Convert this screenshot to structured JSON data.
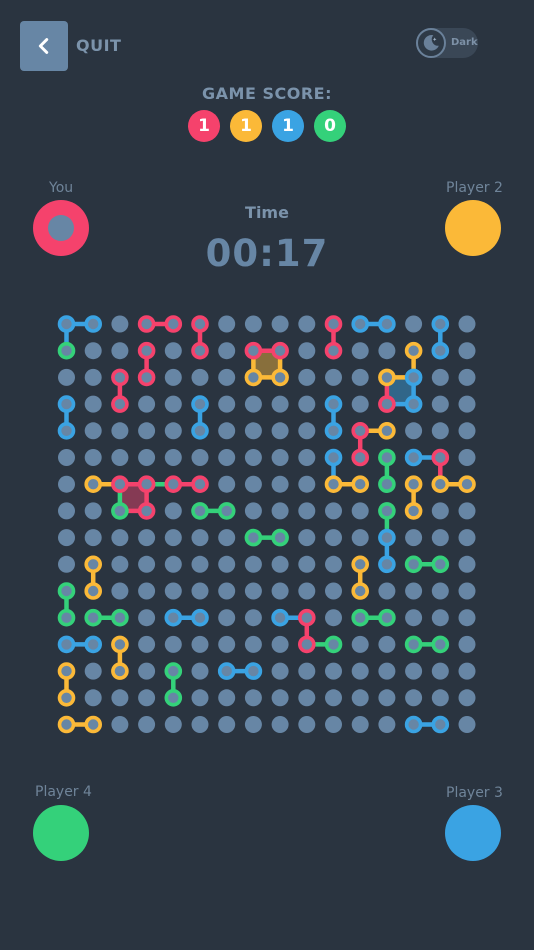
{
  "header": {
    "quit_label": "QUIT",
    "theme_label": "Dark",
    "back_icon": "chevron-left-icon",
    "theme_icon": "moon-icon"
  },
  "score": {
    "title": "GAME SCORE:",
    "values": [
      {
        "value": "1",
        "color": "#f5426c"
      },
      {
        "value": "1",
        "color": "#fbb938"
      },
      {
        "value": "1",
        "color": "#3aa3e3"
      },
      {
        "value": "0",
        "color": "#34d17a"
      }
    ]
  },
  "players": {
    "you": {
      "label": "You",
      "color": "#f5426c"
    },
    "p2": {
      "label": "Player 2",
      "color": "#fbb938"
    },
    "p3": {
      "label": "Player 3",
      "color": "#3aa3e3"
    },
    "p4": {
      "label": "Player 4",
      "color": "#34d17a"
    }
  },
  "timer": {
    "label": "Time",
    "value": "00:17"
  },
  "colors": {
    "R": "#f5426c",
    "Y": "#fbb938",
    "B": "#3aa3e3",
    "G": "#34d17a",
    "dot": "#6786a5",
    "background": "#2a3440"
  },
  "board": {
    "cols": 16,
    "rows": 16,
    "lines": [
      [
        "B",
        0,
        0,
        1,
        0
      ],
      [
        "B",
        0,
        0,
        0,
        1
      ],
      [
        "G",
        0,
        1,
        0,
        1
      ],
      [
        "R",
        3,
        0,
        4,
        0
      ],
      [
        "R",
        5,
        0,
        5,
        1
      ],
      [
        "R",
        3,
        1,
        3,
        2
      ],
      [
        "R",
        2,
        2,
        2,
        3
      ],
      [
        "R",
        7,
        1,
        8,
        1
      ],
      [
        "R",
        10,
        0,
        10,
        1
      ],
      [
        "B",
        11,
        0,
        12,
        0
      ],
      [
        "B",
        14,
        0,
        14,
        1
      ],
      [
        "Y",
        13,
        1,
        13,
        2
      ],
      [
        "Y",
        7,
        2,
        8,
        2
      ],
      [
        "Y",
        7,
        1,
        7,
        2
      ],
      [
        "Y",
        8,
        1,
        8,
        2
      ],
      [
        "Y",
        12,
        2,
        13,
        2
      ],
      [
        "B",
        13,
        3,
        12,
        3
      ],
      [
        "R",
        12,
        2,
        12,
        3
      ],
      [
        "B",
        13,
        2,
        13,
        3
      ],
      [
        "B",
        0,
        3,
        0,
        4
      ],
      [
        "B",
        5,
        3,
        5,
        4
      ],
      [
        "B",
        10,
        3,
        10,
        4
      ],
      [
        "R",
        11,
        4,
        11,
        5
      ],
      [
        "Y",
        11,
        4,
        12,
        4
      ],
      [
        "B",
        10,
        5,
        10,
        6
      ],
      [
        "Y",
        10,
        6,
        11,
        6
      ],
      [
        "G",
        12,
        5,
        12,
        6
      ],
      [
        "B",
        13,
        5,
        14,
        5
      ],
      [
        "R",
        14,
        5,
        14,
        6
      ],
      [
        "Y",
        14,
        6,
        15,
        6
      ],
      [
        "Y",
        13,
        6,
        13,
        7
      ],
      [
        "Y",
        1,
        6,
        2,
        6
      ],
      [
        "R",
        2,
        6,
        3,
        6
      ],
      [
        "G",
        3,
        6,
        4,
        6
      ],
      [
        "R",
        4,
        6,
        5,
        6
      ],
      [
        "G",
        2,
        6,
        2,
        7
      ],
      [
        "R",
        2,
        7,
        3,
        7
      ],
      [
        "R",
        3,
        6,
        3,
        7
      ],
      [
        "G",
        5,
        7,
        6,
        7
      ],
      [
        "G",
        12,
        7,
        12,
        8
      ],
      [
        "G",
        7,
        8,
        8,
        8
      ],
      [
        "B",
        12,
        8,
        12,
        9
      ],
      [
        "G",
        13,
        9,
        14,
        9
      ],
      [
        "Y",
        1,
        9,
        1,
        10
      ],
      [
        "Y",
        11,
        9,
        11,
        10
      ],
      [
        "G",
        0,
        10,
        0,
        11
      ],
      [
        "G",
        1,
        11,
        2,
        11
      ],
      [
        "B",
        4,
        11,
        5,
        11
      ],
      [
        "B",
        8,
        11,
        9,
        11
      ],
      [
        "R",
        9,
        11,
        9,
        12
      ],
      [
        "G",
        9,
        12,
        10,
        12
      ],
      [
        "G",
        11,
        11,
        12,
        11
      ],
      [
        "B",
        0,
        12,
        1,
        12
      ],
      [
        "Y",
        2,
        12,
        2,
        13
      ],
      [
        "G",
        13,
        12,
        14,
        12
      ],
      [
        "Y",
        0,
        13,
        0,
        14
      ],
      [
        "G",
        4,
        13,
        4,
        14
      ],
      [
        "B",
        6,
        13,
        7,
        13
      ],
      [
        "Y",
        0,
        15,
        1,
        15
      ],
      [
        "B",
        13,
        15,
        14,
        15
      ]
    ],
    "squares": [
      {
        "color": "Y",
        "col": 7,
        "row": 1
      },
      {
        "color": "B",
        "col": 12,
        "row": 2
      },
      {
        "color": "R",
        "col": 2,
        "row": 6
      }
    ],
    "dots": [
      [
        "B",
        0,
        0
      ],
      [
        "B",
        1,
        0
      ],
      [
        "R",
        3,
        0
      ],
      [
        "R",
        4,
        0
      ],
      [
        "R",
        5,
        0
      ],
      [
        "R",
        10,
        0
      ],
      [
        "B",
        11,
        0
      ],
      [
        "B",
        12,
        0
      ],
      [
        "B",
        14,
        0
      ],
      [
        "G",
        0,
        1
      ],
      [
        "R",
        3,
        1
      ],
      [
        "R",
        5,
        1
      ],
      [
        "R",
        7,
        1
      ],
      [
        "R",
        8,
        1
      ],
      [
        "R",
        10,
        1
      ],
      [
        "Y",
        13,
        1
      ],
      [
        "B",
        14,
        1
      ],
      [
        "R",
        2,
        2
      ],
      [
        "R",
        3,
        2
      ],
      [
        "Y",
        7,
        2
      ],
      [
        "Y",
        8,
        2
      ],
      [
        "Y",
        12,
        2
      ],
      [
        "B",
        13,
        2
      ],
      [
        "B",
        0,
        3
      ],
      [
        "R",
        2,
        3
      ],
      [
        "B",
        5,
        3
      ],
      [
        "B",
        10,
        3
      ],
      [
        "R",
        12,
        3
      ],
      [
        "B",
        13,
        3
      ],
      [
        "B",
        0,
        4
      ],
      [
        "B",
        5,
        4
      ],
      [
        "B",
        10,
        4
      ],
      [
        "R",
        11,
        4
      ],
      [
        "Y",
        12,
        4
      ],
      [
        "B",
        10,
        5
      ],
      [
        "R",
        11,
        5
      ],
      [
        "G",
        12,
        5
      ],
      [
        "B",
        13,
        5
      ],
      [
        "R",
        14,
        5
      ],
      [
        "Y",
        1,
        6
      ],
      [
        "R",
        2,
        6
      ],
      [
        "R",
        3,
        6
      ],
      [
        "R",
        4,
        6
      ],
      [
        "R",
        5,
        6
      ],
      [
        "Y",
        10,
        6
      ],
      [
        "Y",
        11,
        6
      ],
      [
        "G",
        12,
        6
      ],
      [
        "Y",
        13,
        6
      ],
      [
        "Y",
        14,
        6
      ],
      [
        "Y",
        15,
        6
      ],
      [
        "G",
        2,
        7
      ],
      [
        "R",
        3,
        7
      ],
      [
        "G",
        5,
        7
      ],
      [
        "G",
        6,
        7
      ],
      [
        "G",
        12,
        7
      ],
      [
        "Y",
        13,
        7
      ],
      [
        "G",
        7,
        8
      ],
      [
        "G",
        8,
        8
      ],
      [
        "B",
        12,
        8
      ],
      [
        "Y",
        1,
        9
      ],
      [
        "Y",
        11,
        9
      ],
      [
        "B",
        12,
        9
      ],
      [
        "G",
        13,
        9
      ],
      [
        "G",
        14,
        9
      ],
      [
        "G",
        0,
        10
      ],
      [
        "Y",
        1,
        10
      ],
      [
        "Y",
        11,
        10
      ],
      [
        "G",
        0,
        11
      ],
      [
        "G",
        1,
        11
      ],
      [
        "G",
        2,
        11
      ],
      [
        "B",
        4,
        11
      ],
      [
        "B",
        5,
        11
      ],
      [
        "B",
        8,
        11
      ],
      [
        "R",
        9,
        11
      ],
      [
        "G",
        11,
        11
      ],
      [
        "G",
        12,
        11
      ],
      [
        "B",
        0,
        12
      ],
      [
        "B",
        1,
        12
      ],
      [
        "Y",
        2,
        12
      ],
      [
        "R",
        9,
        12
      ],
      [
        "G",
        10,
        12
      ],
      [
        "G",
        13,
        12
      ],
      [
        "G",
        14,
        12
      ],
      [
        "Y",
        0,
        13
      ],
      [
        "Y",
        2,
        13
      ],
      [
        "G",
        4,
        13
      ],
      [
        "B",
        6,
        13
      ],
      [
        "B",
        7,
        13
      ],
      [
        "Y",
        0,
        14
      ],
      [
        "G",
        4,
        14
      ],
      [
        "Y",
        0,
        15
      ],
      [
        "Y",
        1,
        15
      ],
      [
        "B",
        13,
        15
      ],
      [
        "B",
        14,
        15
      ]
    ]
  }
}
